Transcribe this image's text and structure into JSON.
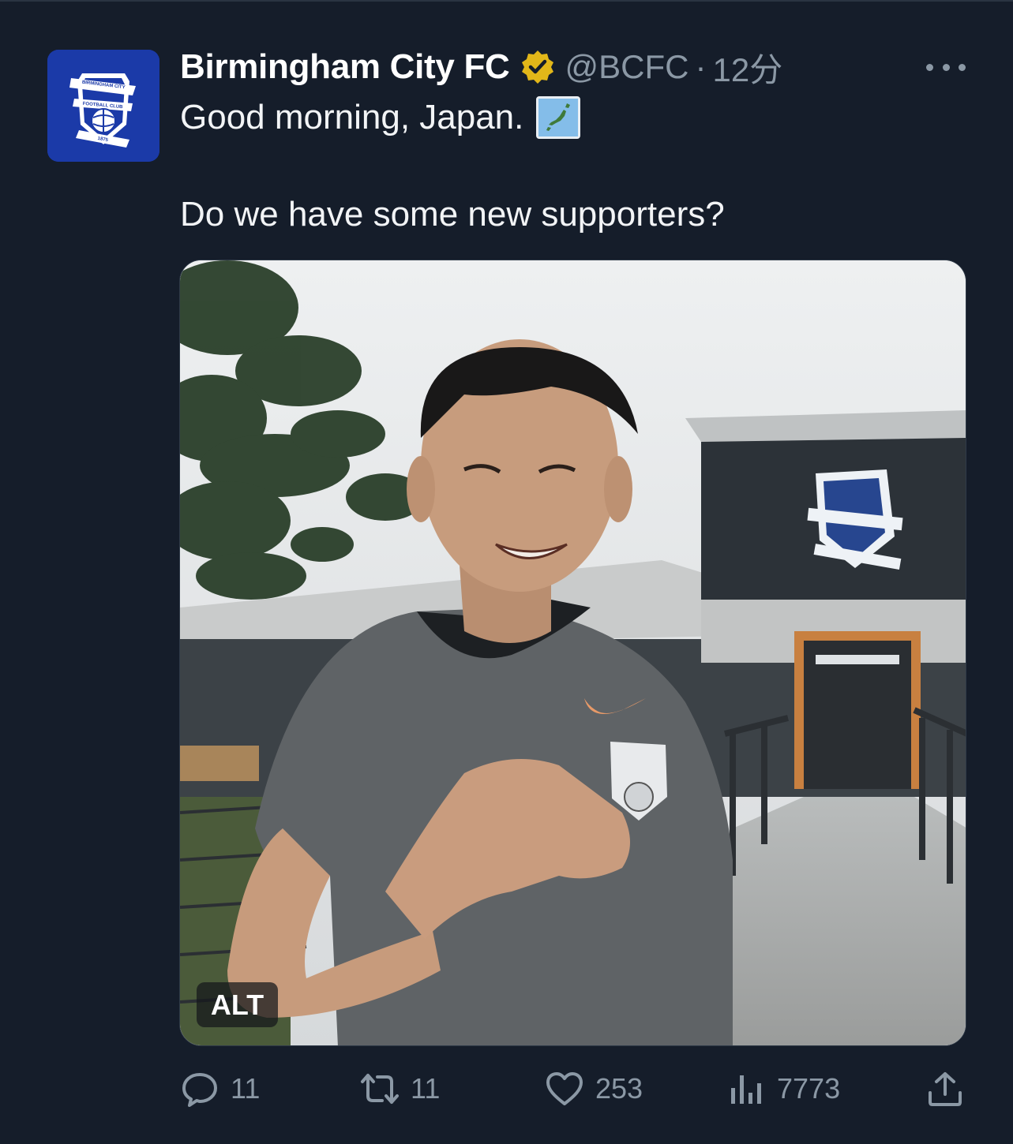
{
  "tweet": {
    "display_name": "Birmingham City FC",
    "verified_icon": "verified-badge-icon",
    "handle": "@BCFC",
    "separator": "·",
    "time": "12分",
    "text_line1": "Good morning, Japan.",
    "flag_emoji": "japan-map-emoji",
    "text_line2": "Do we have some new supporters?",
    "media_alt_label": "ALT"
  },
  "avatar": {
    "crest_top": "BIRMINGHAM CITY",
    "crest_mid": "FOOTBALL CLUB",
    "crest_year": "1875"
  },
  "actions": {
    "reply_count": "11",
    "retweet_count": "11",
    "like_count": "253",
    "views_count": "7773"
  },
  "colors": {
    "background": "#151d2a",
    "secondary_text": "#8b98a5",
    "verified_gold": "#e2b719",
    "avatar_blue": "#1b3aa8"
  }
}
